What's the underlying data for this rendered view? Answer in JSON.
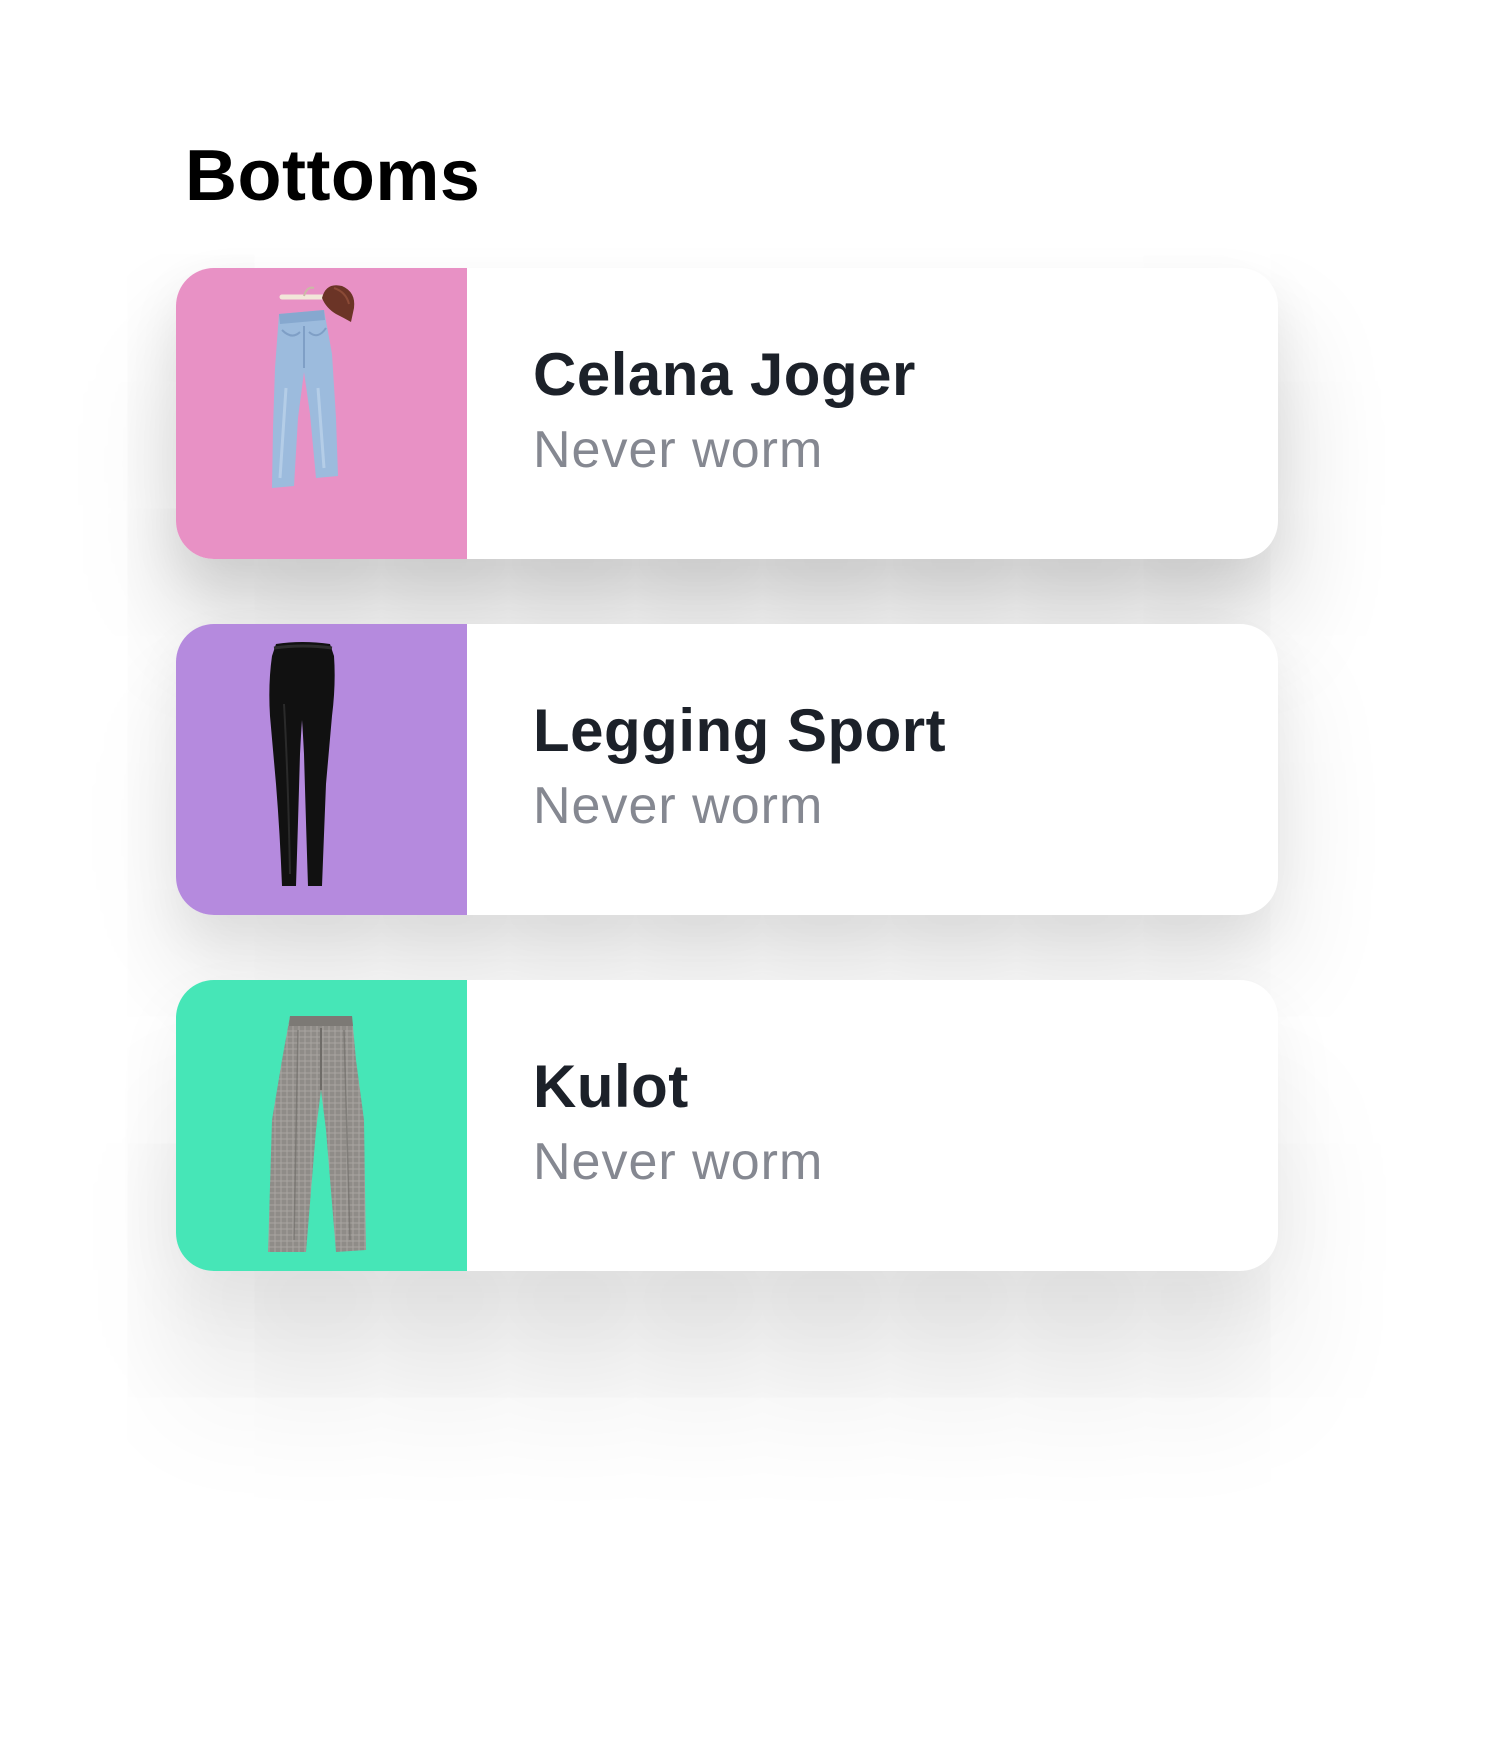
{
  "section": {
    "title": "Bottoms"
  },
  "items": [
    {
      "name": "Celana Joger",
      "status": "Never worm",
      "thumb_color": "#e891c5",
      "icon": "jeans-on-hanger-icon"
    },
    {
      "name": "Legging Sport",
      "status": "Never worm",
      "thumb_color": "#b58ade",
      "icon": "leggings-icon"
    },
    {
      "name": "Kulot",
      "status": "Never worm",
      "thumb_color": "#46e6b7",
      "icon": "wide-trousers-icon"
    }
  ]
}
